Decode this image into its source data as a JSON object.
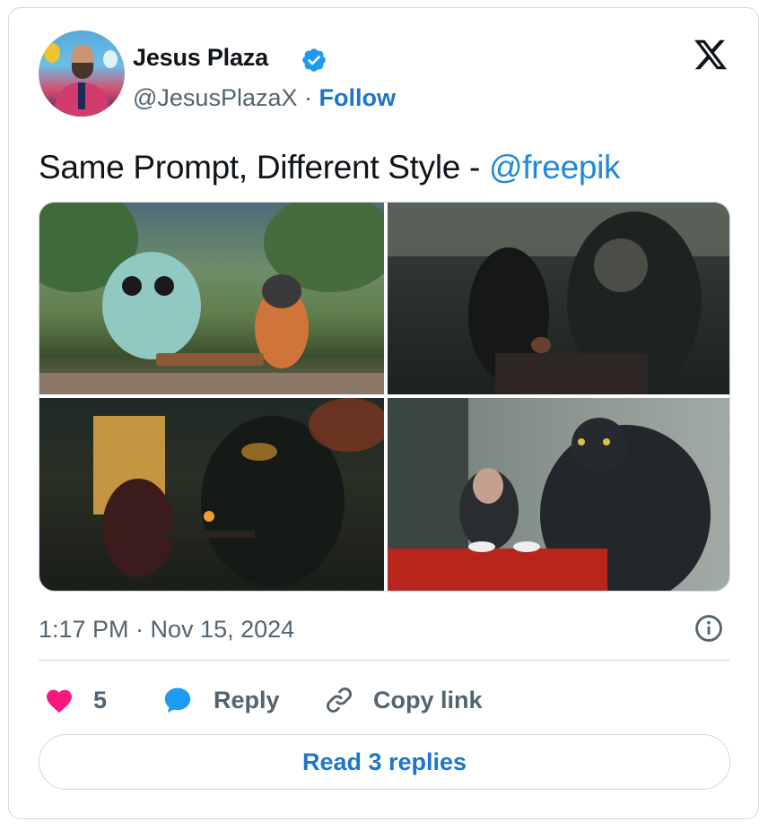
{
  "tweet": {
    "author_name": "Jesus Plaza",
    "handle": "@JesusPlazaX",
    "separator": "·",
    "follow_label": "Follow",
    "text": "Same Prompt, Different Style - ",
    "mention": "@freepik",
    "timestamp": "1:17 PM · Nov 15, 2024",
    "images": [
      "cute-fluffy-monster-and-samurai-tea-party",
      "dark-horror-creatures-at-table",
      "samurai-and-dark-beast-tea-scene",
      "woman-and-giant-black-cat-at-red-table"
    ]
  },
  "actions": {
    "like_count": "5",
    "reply_label": "Reply",
    "copy_link_label": "Copy link",
    "read_replies_label": "Read 3 replies"
  },
  "colors": {
    "accent": "#1d76c9",
    "like": "#f91880",
    "reply_bubble": "#1d9bf0",
    "verified": "#1d9bf0",
    "muted": "#536471",
    "border": "#cfd9de"
  },
  "icons": [
    "verified-badge-icon",
    "x-logo-icon",
    "info-icon",
    "heart-icon",
    "reply-bubble-icon",
    "link-icon"
  ]
}
